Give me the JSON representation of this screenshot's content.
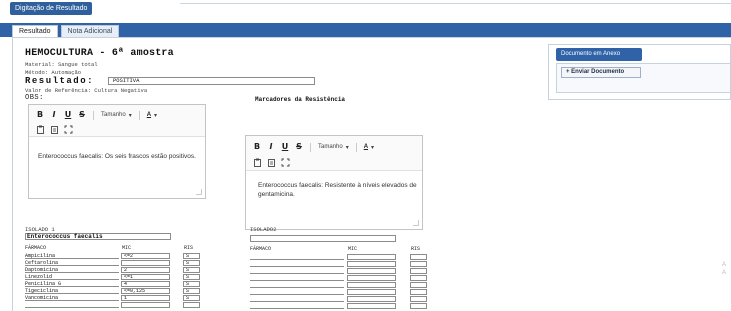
{
  "window": {
    "title_tag": "Digitação de Resultado"
  },
  "tabs": [
    {
      "label": "Resultado",
      "active": true
    },
    {
      "label": "Nota Adicional",
      "active": false
    }
  ],
  "exam": {
    "title": "HEMOCULTURA - 6ª amostra",
    "material": "Material: Sangue total",
    "method": "Método: Automação",
    "result_label": "Resultado:",
    "result_value": "POSITIVA",
    "reference": "Valor de Referência: Cultura Negativa",
    "obs_label": "OBS:",
    "markers_title": "Marcadores da Resistência"
  },
  "editor_toolbar": {
    "bold": "B",
    "italic": "I",
    "underline": "U",
    "strike": "S",
    "size_label": "Tamanho",
    "font_color": "A"
  },
  "obs_editor": {
    "text": "Enterococcus faecalis: Os seis frascos estão positivos."
  },
  "markers_editor": {
    "text": "Enterococcus faecalis: Resistente à níveis elevados de gentamicina."
  },
  "isolate1": {
    "label": "ISOLADO 1",
    "organism": "Enterococcus faecalis",
    "headers": {
      "drug": "FÁRMACO",
      "mic": "MIC",
      "ris": "RIS"
    },
    "rows": [
      {
        "drug": "Ampicilina",
        "mic": "<=2",
        "ris": "S"
      },
      {
        "drug": "Ceftarolina",
        "mic": "",
        "ris": "S"
      },
      {
        "drug": "Daptomicina",
        "mic": "2",
        "ris": "S"
      },
      {
        "drug": "Linezolid",
        "mic": "<=1",
        "ris": "S"
      },
      {
        "drug": "Penicilina G",
        "mic": "4",
        "ris": "S"
      },
      {
        "drug": "Tigeciclina",
        "mic": "<=0,125",
        "ris": "S"
      },
      {
        "drug": "Vancomicina",
        "mic": "1",
        "ris": "S"
      },
      {
        "drug": "",
        "mic": "",
        "ris": ""
      }
    ]
  },
  "isolate2": {
    "label": "ISOLADO2",
    "organism": "",
    "headers": {
      "drug": "FÁRMACO",
      "mic": "MIC",
      "ris": "RIS"
    },
    "rows": [
      {
        "drug": "",
        "mic": "",
        "ris": ""
      },
      {
        "drug": "",
        "mic": "",
        "ris": ""
      },
      {
        "drug": "",
        "mic": "",
        "ris": ""
      },
      {
        "drug": "",
        "mic": "",
        "ris": ""
      },
      {
        "drug": "",
        "mic": "",
        "ris": ""
      },
      {
        "drug": "",
        "mic": "",
        "ris": ""
      },
      {
        "drug": "",
        "mic": "",
        "ris": ""
      },
      {
        "drug": "",
        "mic": "",
        "ris": ""
      }
    ]
  },
  "documents": {
    "panel_title": "Documento em Anexo",
    "send_button": "+ Enviar Documento"
  },
  "faint_text": [
    "A",
    "A"
  ],
  "colors": {
    "header": "#2f62a6",
    "title_tag": "#2f5f9c"
  }
}
